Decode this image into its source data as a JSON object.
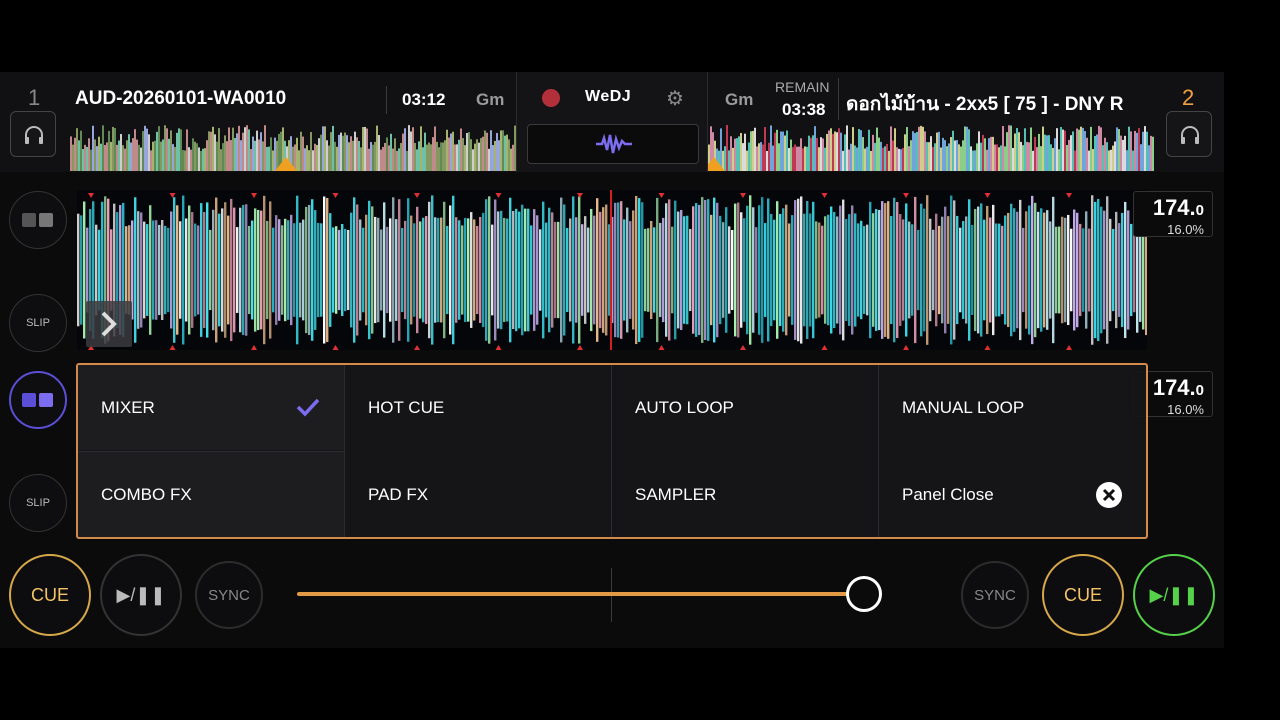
{
  "deck1": {
    "number": "1",
    "title": "AUD-20260101-WA0010",
    "time": "03:12",
    "key": "Gm",
    "bpm_main": "174.",
    "bpm_dec": "0",
    "pitch": "16.0%"
  },
  "deck2": {
    "number": "2",
    "title": "ดอกไม้บ้าน - 2xx5 [ 75 ] - DNY R",
    "key": "Gm",
    "remain_label": "REMAIN",
    "remain_time": "03:38",
    "bpm_main": "174.",
    "bpm_dec": "0",
    "pitch": "16.0%"
  },
  "center": {
    "brand": "WeDJ"
  },
  "side": {
    "slip_top": "SLIP",
    "slip_bottom": "SLIP"
  },
  "panel": {
    "items": [
      {
        "label": "MIXER",
        "selected": true
      },
      {
        "label": "HOT CUE"
      },
      {
        "label": "AUTO LOOP"
      },
      {
        "label": "MANUAL LOOP"
      },
      {
        "label": "COMBO FX"
      },
      {
        "label": "PAD FX"
      },
      {
        "label": "SAMPLER"
      },
      {
        "label": "Panel Close"
      }
    ]
  },
  "transport": {
    "cue_left": "CUE",
    "play_left": "▶/❚❚",
    "sync_left": "SYNC",
    "sync_right": "SYNC",
    "cue_right": "CUE",
    "play_right": "▶/❚❚",
    "crossfader_position": 0.9
  },
  "colors": {
    "accent_orange": "#d38a4a",
    "cue_gold": "#d6a84a",
    "play_green": "#55d24a",
    "selected_purple": "#7b6cf0"
  }
}
